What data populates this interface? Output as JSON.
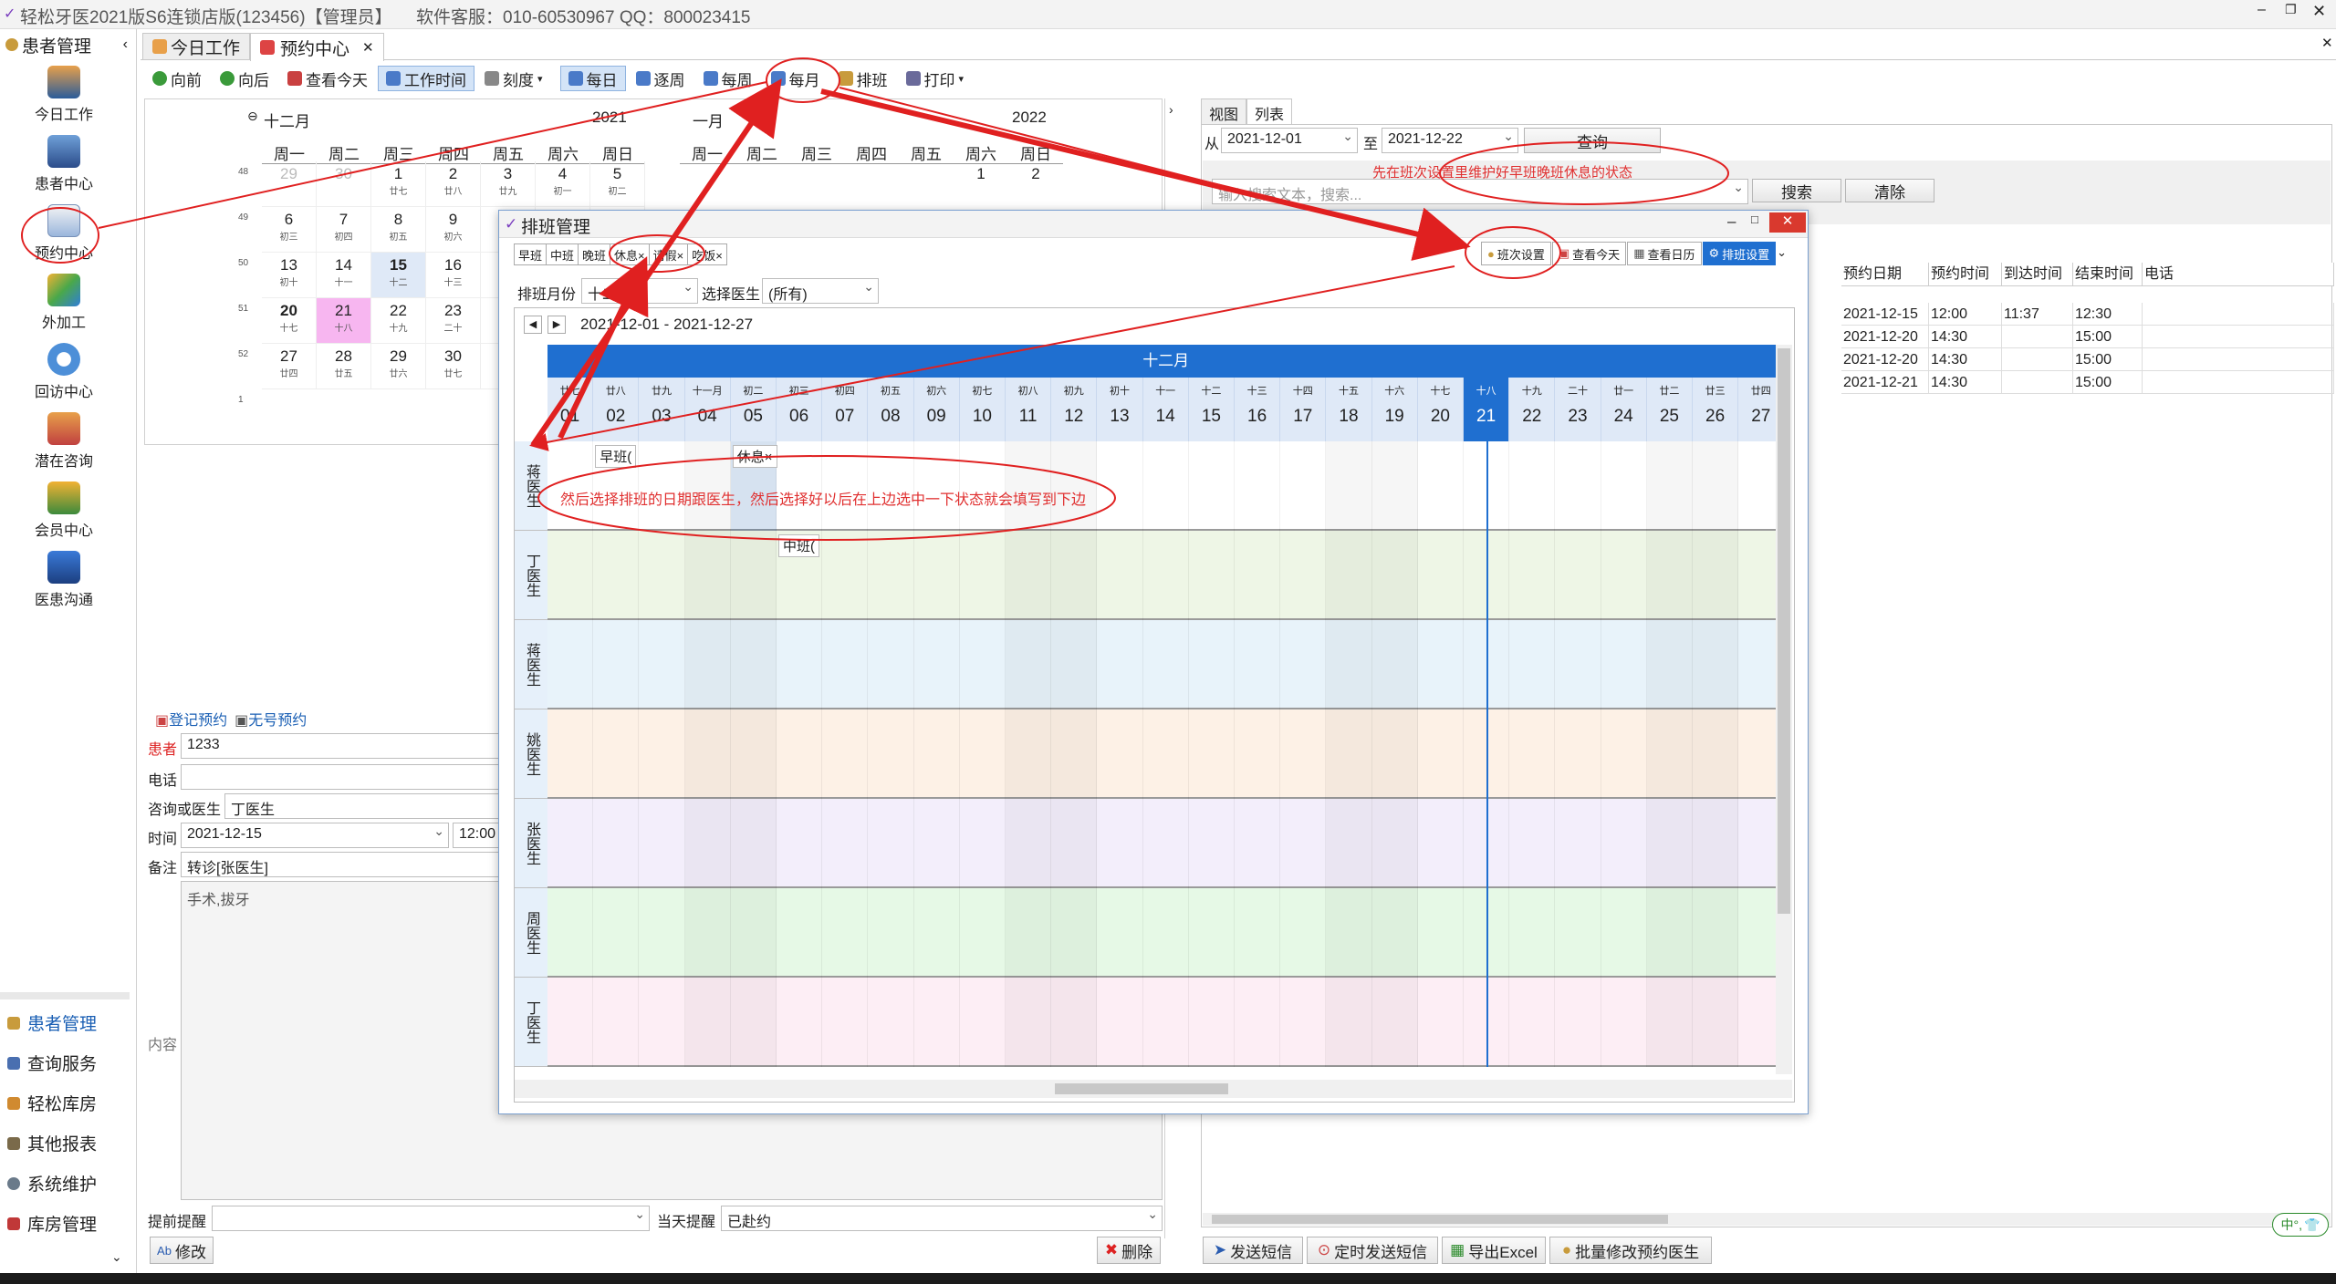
{
  "app": {
    "title": "轻松牙医2021版S6连锁店版(123456)【管理员】",
    "service": "软件客服：010-60530967 QQ：800023415"
  },
  "sidebar": {
    "header": "患者管理",
    "items": [
      "今日工作",
      "患者中心",
      "预约中心",
      "外加工",
      "回访中心",
      "潜在咨询",
      "会员中心",
      "医患沟通"
    ],
    "more": "......",
    "bottom": [
      "患者管理",
      "查询服务",
      "轻松库房",
      "其他报表",
      "系统维护",
      "库房管理"
    ]
  },
  "tabs": [
    "今日工作",
    "预约中心"
  ],
  "toolbar": {
    "buttons": [
      "向前",
      "向后",
      "查看今天",
      "工作时间",
      "刻度",
      "每日",
      "逐周",
      "每周",
      "每月",
      "排班",
      "打印"
    ]
  },
  "minical": {
    "left": {
      "month": "十二月",
      "year": "2021"
    },
    "right": {
      "month": "一月",
      "year": "2022"
    },
    "weekdays": [
      "周一",
      "周二",
      "周三",
      "周四",
      "周五",
      "周六",
      "周日"
    ],
    "weeknums": [
      "48",
      "49",
      "50",
      "51",
      "52",
      "1"
    ],
    "rows": [
      [
        [
          "29",
          ""
        ],
        [
          "30",
          ""
        ],
        [
          "1",
          "廿七"
        ],
        [
          "2",
          "廿八"
        ],
        [
          "3",
          "廿九"
        ],
        [
          "4",
          "初一"
        ],
        [
          "5",
          "初二"
        ]
      ],
      [
        [
          "6",
          "初三"
        ],
        [
          "7",
          "初四"
        ],
        [
          "8",
          "初五"
        ],
        [
          "9",
          "初六"
        ],
        [
          "10",
          "初七"
        ],
        [
          "11",
          "初八"
        ],
        [
          "12",
          "初九"
        ]
      ],
      [
        [
          "13",
          "初十"
        ],
        [
          "14",
          "十一"
        ],
        [
          "15",
          "十二"
        ],
        [
          "16",
          "十三"
        ],
        [
          "17",
          "十四"
        ],
        [
          "18",
          "十五"
        ],
        [
          "19",
          "十六"
        ]
      ],
      [
        [
          "20",
          "十七"
        ],
        [
          "21",
          "十八"
        ],
        [
          "22",
          "十九"
        ],
        [
          "23",
          "二十"
        ],
        [
          "24",
          "廿一"
        ],
        [
          "25",
          "廿二"
        ],
        [
          "26",
          "廿三"
        ]
      ],
      [
        [
          "27",
          "廿四"
        ],
        [
          "28",
          "廿五"
        ],
        [
          "29",
          "廿六"
        ],
        [
          "30",
          "廿七"
        ],
        [
          "31",
          "廿八"
        ],
        [
          "",
          ""
        ],
        [
          "",
          ""
        ]
      ]
    ],
    "right_first": [
      "",
      "",
      "",
      "",
      "",
      "1",
      "2"
    ]
  },
  "form": {
    "tab1": "登记预约",
    "tab2": "无号预约",
    "patient_label": "患者",
    "patient": "1233",
    "phone_label": "电话",
    "doctor_label": "咨询或医生",
    "doctor": "丁医生",
    "time_label": "时间",
    "date": "2021-12-15",
    "time": "12:00",
    "note_label": "备注",
    "note": "转诊[张医生]",
    "content_label": "内容",
    "content": "手术,拔牙",
    "remind_label": "提前提醒",
    "today_label": "当天提醒",
    "today_val": "已赴约",
    "edit": "修改",
    "delete": "删除"
  },
  "right": {
    "tabs": [
      "视图",
      "列表"
    ],
    "from_label": "从",
    "from": "2021-12-01",
    "to_label": "至",
    "to": "2021-12-22",
    "query": "查询",
    "search_placeholder": "输入搜索文本，搜索...",
    "search": "搜索",
    "clear": "清除",
    "columns": [
      "预约日期",
      "预约时间",
      "到达时间",
      "结束时间",
      "电话"
    ],
    "rows": [
      [
        "2021-12-15",
        "12:00",
        "11:37",
        "12:30",
        ""
      ],
      [
        "2021-12-20",
        "14:30",
        "",
        "15:00",
        ""
      ],
      [
        "2021-12-20",
        "14:30",
        "",
        "15:00",
        ""
      ],
      [
        "2021-12-21",
        "14:30",
        "",
        "15:00",
        ""
      ]
    ],
    "bottom_buttons": [
      "发送短信",
      "定时发送短信",
      "导出Excel",
      "批量修改预约医生"
    ]
  },
  "dialog": {
    "title": "排班管理",
    "shift_tags": [
      "早班",
      "中班",
      "晚班",
      "休息×",
      "请假×",
      "吃饭×"
    ],
    "buttons": [
      "班次设置",
      "查看今天",
      "查看日历",
      "排班设置"
    ],
    "month_label": "排班月份",
    "month": "十二月",
    "doctor_label": "选择医生",
    "doctor": "(所有)",
    "range": "2021-12-01 - 2021-12-27",
    "header_month": "十二月",
    "lunar": [
      "廿七",
      "廿八",
      "廿九",
      "十一月",
      "初二",
      "初三",
      "初四",
      "初五",
      "初六",
      "初七",
      "初八",
      "初九",
      "初十",
      "十一",
      "十二",
      "十三",
      "十四",
      "十五",
      "十六",
      "十七",
      "十八",
      "十九",
      "二十",
      "廿一",
      "廿二",
      "廿三",
      "廿四"
    ],
    "days": [
      "01",
      "02",
      "03",
      "04",
      "05",
      "06",
      "07",
      "08",
      "09",
      "10",
      "11",
      "12",
      "13",
      "14",
      "15",
      "16",
      "17",
      "18",
      "19",
      "20",
      "21",
      "22",
      "23",
      "24",
      "25",
      "26",
      "27"
    ],
    "today_index": 20,
    "doctors": [
      "蒋医生",
      "丁医生",
      "蒋医生",
      "姚医生",
      "张医生",
      "周医生",
      "丁医生"
    ],
    "row_colors": [
      "#ffffff",
      "#eef6e6",
      "#e8f3fa",
      "#fdf1e6",
      "#f3eefb",
      "#e6f9e6",
      "#fdeef5"
    ],
    "events": [
      {
        "text": "早班(",
        "row": 0,
        "day": 1
      },
      {
        "text": "休息×",
        "row": 0,
        "day": 4
      },
      {
        "text": "中班(",
        "row": 1,
        "day": 5
      }
    ]
  },
  "annotations": {
    "top": "先在班次设置里维护好早班晚班休息的状态",
    "bottom": "然后选择排班的日期跟医生，然后选择好以后在上边选中一下状态就会填写到下边"
  },
  "ime": "中°,"
}
